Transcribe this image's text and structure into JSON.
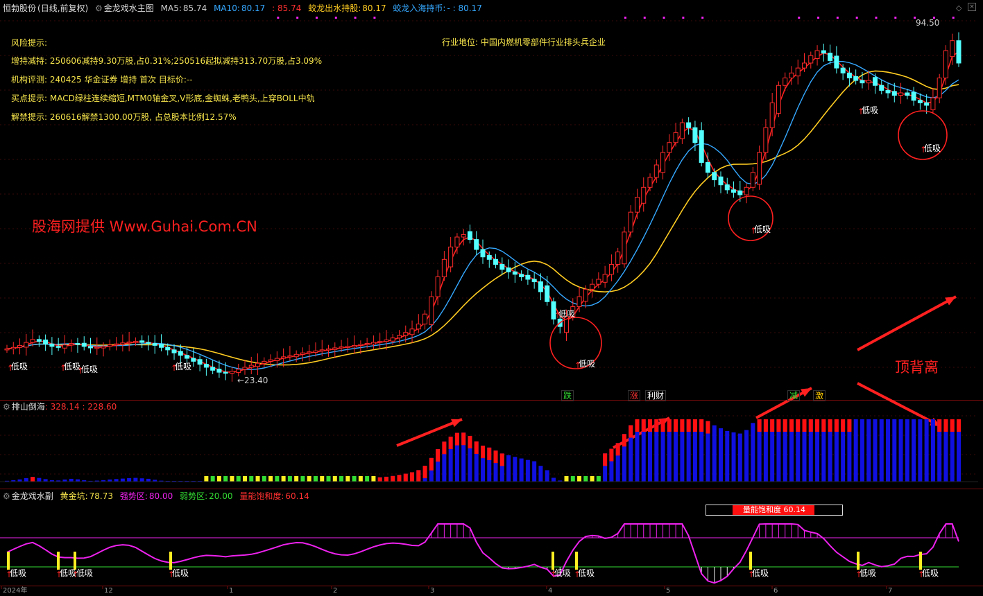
{
  "main_header": {
    "stock": "恒勃股份",
    "period": "(日线,前复权)",
    "indicator": "金龙戏水主图",
    "ma5_label": "MA5:",
    "ma5_value": "85.74",
    "ma10_label": "MA10:",
    "ma10_value": "80.17",
    "extra_value": ": 85.74",
    "jiaolong_label": "蛟龙出水持股:",
    "jiaolong_value": "80.17",
    "rushai_label": "蛟龙入海持币:",
    "rushai_value": "- : 80.17"
  },
  "info": {
    "risk_title": "风险提示:",
    "line1": "增持减持: 250606减持9.30万股,占0.31%;250516起拟减持313.70万股,占3.09%",
    "line2": "机构评测: 240425 华金证券 增持 首次 目标价:--",
    "line3": "买点提示: MACD绿柱连续缩短,MTM0轴金叉,V形底,金蜘蛛,老鸭头,上穿BOLL中轨",
    "line4": "解禁提示: 260616解禁1300.00万股, 占总股本比例12.57%",
    "industry": "行业地位: 中国内燃机零部件行业排头兵企业"
  },
  "watermark": "股海网提供 Www.Guhai.Com.CN",
  "top_divergence": "顶背离",
  "high_label": "94.50",
  "low_label": "←23.40",
  "signal_text": "低吸",
  "events": [
    {
      "text": "跌",
      "color": "#33dd33"
    },
    {
      "text": "涨",
      "color": "#ff3333"
    },
    {
      "text": "利财",
      "color": "#ffffff"
    },
    {
      "text": "减",
      "color": "#33dd33"
    },
    {
      "text": "激",
      "color": "#ffcc00"
    }
  ],
  "sub1_header": {
    "name": "排山倒海",
    "values": ": 328.14 : 228.60"
  },
  "sub2_header": {
    "name": "金龙戏水副",
    "huangjin_label": "黄金坑:",
    "huangjin_value": "78.73",
    "qiang_label": "强势区:",
    "qiang_value": "80.00",
    "ruo_label": "弱势区:",
    "ruo_value": "20.00",
    "baohe_label": "量能饱和度:",
    "baohe_value": "60.14"
  },
  "saturation_box": "量能饱和度 60.14",
  "x_axis": [
    "2024年",
    "12",
    "1",
    "2",
    "3",
    "4",
    "5",
    "6",
    "7"
  ],
  "colors": {
    "up": "#ff2a2a",
    "down": "#54ffff",
    "ma5": "#ff2020",
    "ma10": "#35a8ff",
    "ma_slow": "#ffcc22",
    "accent_yellow": "#f5e34b",
    "magenta": "#ee22ee",
    "bar_blue": "#1010e0",
    "bar_red": "#ff1010"
  },
  "chart_data": {
    "type": "candlestick",
    "title": "",
    "high": 94.5,
    "low": 23.4,
    "ma5_last": 85.74,
    "ma10_last": 80.17,
    "closes": [
      28.5,
      28.8,
      29.2,
      29.8,
      30.4,
      30.0,
      29.5,
      29.0,
      28.9,
      29.3,
      29.6,
      29.4,
      29.0,
      28.7,
      28.8,
      29.0,
      29.3,
      29.5,
      29.7,
      29.9,
      30.0,
      29.8,
      29.6,
      29.2,
      28.8,
      28.3,
      27.7,
      27.2,
      26.6,
      26.0,
      25.4,
      24.8,
      24.2,
      23.8,
      23.6,
      24.0,
      24.4,
      24.8,
      25.2,
      25.6,
      26.0,
      26.3,
      26.6,
      26.9,
      27.1,
      27.4,
      27.7,
      27.9,
      28.1,
      28.3,
      28.5,
      28.7,
      28.9,
      29.0,
      29.2,
      29.4,
      29.6,
      29.8,
      30.0,
      30.3,
      30.7,
      31.2,
      31.8,
      32.5,
      33.5,
      35.5,
      39.0,
      43.0,
      46.5,
      49.0,
      51.0,
      51.5,
      50.5,
      48.5,
      47.0,
      46.5,
      45.5,
      44.5,
      44.0,
      43.5,
      43.0,
      42.5,
      42.0,
      40.0,
      38.0,
      34.5,
      33.0,
      35.0,
      37.0,
      39.0,
      40.5,
      41.5,
      42.5,
      43.5,
      45.5,
      48.0,
      52.0,
      56.0,
      59.0,
      61.0,
      63.0,
      65.5,
      68.0,
      70.0,
      72.0,
      74.0,
      73.0,
      70.0,
      66.0,
      64.0,
      62.5,
      61.5,
      60.5,
      60.0,
      59.5,
      61.0,
      64.0,
      68.0,
      73.0,
      78.0,
      81.5,
      83.0,
      84.0,
      85.0,
      86.0,
      87.5,
      88.5,
      88.0,
      86.5,
      85.0,
      84.0,
      83.0,
      82.5,
      82.0,
      82.5,
      81.5,
      80.5,
      80.0,
      79.5,
      80.0,
      79.5,
      78.5,
      78.0,
      77.5,
      79.0,
      83.0,
      88.5,
      90.5,
      86.0
    ]
  }
}
